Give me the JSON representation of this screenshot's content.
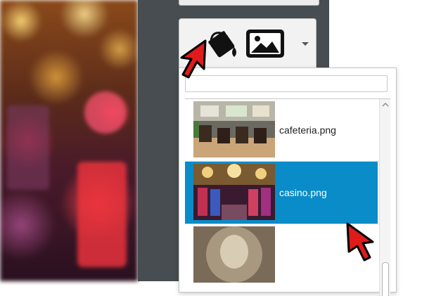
{
  "background_picker": {
    "fill_icon": "paint-bucket-icon",
    "image_icon": "image-icon",
    "dropdown_icon": "chevron-down-icon"
  },
  "image_list": {
    "search_value": "",
    "items": [
      {
        "label": "cafeteria.png",
        "selected": false
      },
      {
        "label": "casino.png",
        "selected": true
      },
      {
        "label": "",
        "selected": false
      }
    ]
  },
  "colors": {
    "panel": "#474d50",
    "selection": "#0a8cc8",
    "pointer": "#e01b1b"
  }
}
